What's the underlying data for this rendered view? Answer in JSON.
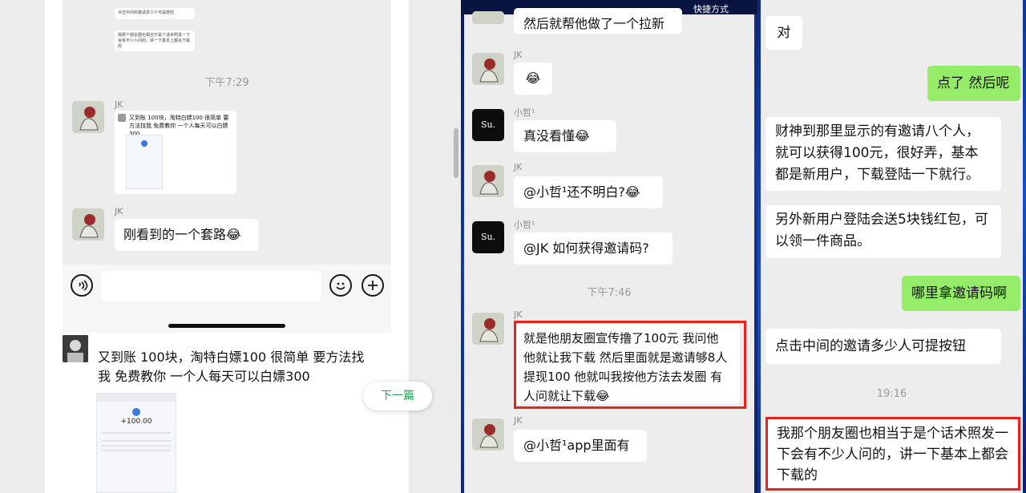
{
  "panel1": {
    "forwarded_top": {
      "line1": "点击中间的邀请多少人可提按钮",
      "line2": "我那个朋友圈也相当于是个话术照发一下会有不少人问的，讲一下基本上都会下载的"
    },
    "time": "下午7:29",
    "msg1": {
      "sender": "JK",
      "text": "又到账 100块，淘特白嫖100 很简单 要方法找我 免费教你 一个人每天可以白嫖300"
    },
    "msg2": {
      "sender": "JK",
      "text": "刚看到的一个套路"
    },
    "post": {
      "text": "又到账 100块，淘特白嫖100 很简单 要方法找我 免费教你 一个人每天可以白嫖300"
    },
    "screenshot_amount": "+100.00",
    "next_button": "下一篇",
    "emoji": "😂"
  },
  "panel2": {
    "top_label": "快捷方式",
    "time": "下午7:46",
    "messages": [
      {
        "sender": "",
        "text": "然后就帮他做了一个拉新"
      },
      {
        "sender": "JK",
        "text": ""
      },
      {
        "sender": "小哲¹",
        "text": "真没看懂"
      },
      {
        "sender": "JK",
        "text": "@小哲¹还不明白?"
      },
      {
        "sender": "小哲¹",
        "text": "@JK 如何获得邀请码?"
      },
      {
        "sender": "JK",
        "text": "就是他朋友圈宣传撸了100元 我问他 他就让我下载 然后里面就是邀请够8人提现100 他就叫我按他方法去发圈 有人问就让下载"
      },
      {
        "sender": "JK",
        "text": "@小哲¹app里面有"
      }
    ],
    "su_label": "Su."
  },
  "panel3": {
    "time": "19:16",
    "messages": [
      {
        "side": "left",
        "text": "对"
      },
      {
        "side": "right",
        "text": "点了 然后呢"
      },
      {
        "side": "left",
        "text": "财神到那里显示的有邀请八个人，就可以获得100元，很好弄，基本都是新用户，下载登陆一下就行。"
      },
      {
        "side": "left",
        "text": "另外新用户登陆会送5块钱红包，可以领一件商品。"
      },
      {
        "side": "right",
        "text": "哪里拿邀请码啊"
      },
      {
        "side": "left",
        "text": "点击中间的邀请多少人可提按钮"
      },
      {
        "side": "left",
        "text": "我那个朋友圈也相当于是个话术照发一下会有不少人问的，讲一下基本上都会下载的"
      }
    ]
  },
  "colors": {
    "wechat_green": "#95ec69",
    "highlight_red": "#e8231f",
    "next_green": "#2aa35a"
  }
}
